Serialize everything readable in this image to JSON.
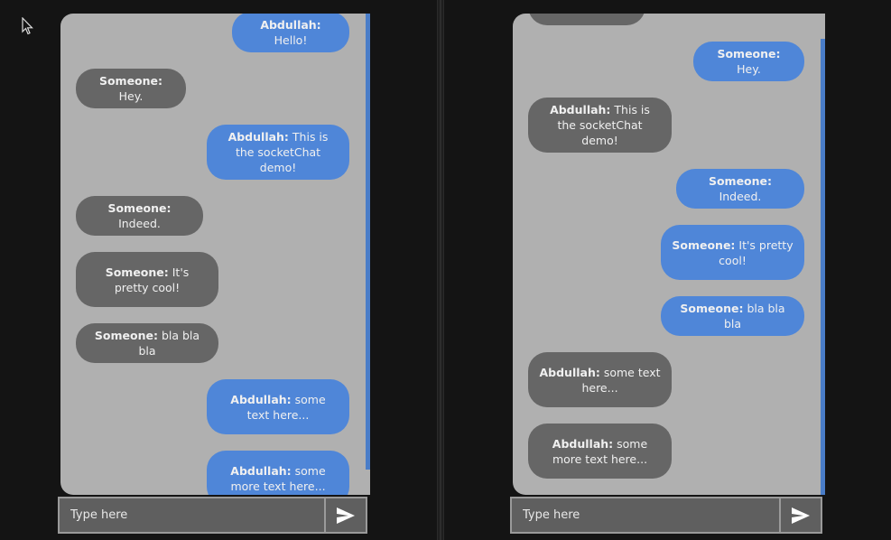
{
  "left_chat": {
    "messages": [
      {
        "from": "Abdullah:",
        "text": " Hello!",
        "kind": "sent"
      },
      {
        "from": "Someone:",
        "text": " Hey.",
        "kind": "recv"
      },
      {
        "from": "Abdullah:",
        "text": " This is the socketChat demo!",
        "kind": "sent"
      },
      {
        "from": "Someone:",
        "text": " Indeed.",
        "kind": "recv"
      },
      {
        "from": "Someone:",
        "text": " It's pretty cool!",
        "kind": "recv"
      },
      {
        "from": "Someone:",
        "text": " bla bla bla",
        "kind": "recv"
      },
      {
        "from": "Abdullah:",
        "text": " some text here...",
        "kind": "sent"
      },
      {
        "from": "Abdullah:",
        "text": " some more text here...",
        "kind": "sent"
      }
    ],
    "input_placeholder": "Type here"
  },
  "right_chat": {
    "messages": [
      {
        "from": "Someone:",
        "text": " Hey.",
        "kind": "sent"
      },
      {
        "from": "Abdullah:",
        "text": " This is the socketChat demo!",
        "kind": "recv"
      },
      {
        "from": "Someone:",
        "text": " Indeed.",
        "kind": "sent"
      },
      {
        "from": "Someone:",
        "text": " It's pretty cool!",
        "kind": "sent"
      },
      {
        "from": "Someone:",
        "text": " bla bla bla",
        "kind": "sent"
      },
      {
        "from": "Abdullah:",
        "text": " some text here...",
        "kind": "recv"
      },
      {
        "from": "Abdullah:",
        "text": " some more text here...",
        "kind": "recv"
      }
    ],
    "input_placeholder": "Type here"
  },
  "colors": {
    "sent_bubble": "#4f86d8",
    "received_bubble": "#666666",
    "panel_bg": "#b0b0b0",
    "page_bg": "#141414"
  },
  "icons": {
    "send": "send-icon",
    "cursor": "mouse-pointer-icon"
  }
}
